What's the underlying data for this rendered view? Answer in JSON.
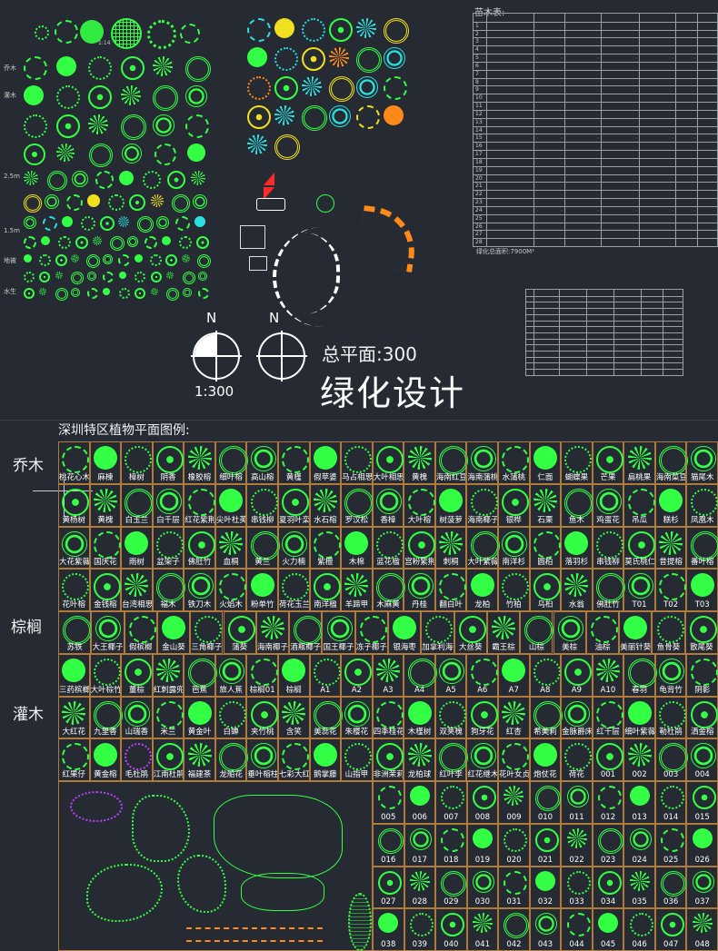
{
  "top": {
    "scale_left": "1:300",
    "north_left": "N",
    "north_right": "N",
    "plan_title": "总平面:300",
    "main_title": "绿化设计",
    "table_title": "苗木表:",
    "table_footer": "绿化总面积:7900M²",
    "table_rows": [
      "1",
      "2",
      "3",
      "4",
      "5",
      "6",
      "7",
      "8",
      "9",
      "10",
      "11",
      "12",
      "13",
      "14",
      "15",
      "16",
      "17",
      "18",
      "19",
      "20",
      "21",
      "22",
      "23",
      "24",
      "25",
      "26",
      "27",
      "28"
    ],
    "left_small_labels": [
      "乔木",
      "灌木",
      "2.5m",
      "1.5m",
      "地被",
      "水生"
    ]
  },
  "legend": {
    "heading": "深圳特区植物平面图例:",
    "sections": [
      "乔木",
      "棕榈",
      "灌木"
    ],
    "row1": [
      "桃花心木",
      "麻楝",
      "樟树",
      "阴香",
      "橡胶榕",
      "细叶榕",
      "高山榕",
      "黄槿",
      "假苹婆",
      "马占相思",
      "大叶相思",
      "黄槐",
      "海南红豆",
      "海南蒲桃",
      "水蒲桃",
      "仁面",
      "蝴蝶果",
      "芒果",
      "扁桃果",
      "海南菜豆",
      "猫尾木"
    ],
    "row2": [
      "黄杨树",
      "黄槐",
      "白玉兰",
      "白千层",
      "红花紫荆",
      "尖叶杜英",
      "串钱柳",
      "夏羽叶栾",
      "水石榕",
      "罗汉松",
      "香樟",
      "大叶榕",
      "树菠萝",
      "海南椰子",
      "银桦",
      "石栗",
      "鱼木",
      "鸡蛋花",
      "吊瓜",
      "糕杉",
      "凤凰木"
    ],
    "row3": [
      "大花紫薇",
      "国庆花",
      "雨树",
      "盆架子",
      "佛肚竹",
      "血桐",
      "黄兰",
      "火力楠",
      "紫檀",
      "木棉",
      "蓝花楹",
      "宫粉紫荆",
      "刺桐",
      "大叶紫薇",
      "南洋杉",
      "圆柏",
      "落羽杉",
      "串钱柳",
      "莫氏桃仁",
      "昔提榕",
      "番叶榕"
    ],
    "row4": [
      "花叶榕",
      "金钱榕",
      "台湾相思",
      "福木",
      "铁刀木",
      "火焰木",
      "粉单竹",
      "荷花玉兰",
      "南洋楹",
      "羊蹄甲",
      "木麻黄",
      "丹桂",
      "翻白叶",
      "龙柏",
      "竹柏",
      "乌桕",
      "水翁",
      "佛肚竹",
      "T01",
      "T02",
      "T03"
    ],
    "row5": [
      "苏铁",
      "大王椰子",
      "假槟榔",
      "金山葵",
      "三角椰子",
      "蒲葵",
      "海南椰子",
      "酒瓶椰子",
      "国王椰子",
      "冻子椰子",
      "银海枣",
      "加拿利海枣",
      "大丝葵",
      "霸王棕",
      "山棕",
      "美棕",
      "油棕",
      "美丽针葵",
      "鱼骨葵",
      "散尾葵"
    ],
    "row6": [
      "三药槟榔",
      "大叶棕竹",
      "董棕",
      "红刺露兜",
      "芭蕉",
      "旅人蕉",
      "棕榈01",
      "棕榈",
      "A1",
      "A2",
      "A3",
      "A4",
      "A5",
      "A6",
      "A7",
      "A8",
      "A9",
      "A10",
      "春羽",
      "龟背竹",
      "阴影"
    ],
    "row7": [
      "大红花",
      "九里香",
      "山瑞香",
      "米兰",
      "黄金叶",
      "白蝉",
      "夹竹桃",
      "含笑",
      "美蕊花",
      "朱樱花",
      "四季桂花",
      "木槿树",
      "双荚槐",
      "狗牙花",
      "红杏",
      "希美莉",
      "金脉爵床",
      "红千层",
      "细叶紫薇",
      "勒杜鹃",
      "洒金榕"
    ],
    "row8": [
      "红果仔",
      "黄金榕",
      "毛杜鹃",
      "江南杜鹃",
      "福建茶",
      "龙船花",
      "垂叶榕柱",
      "七彩大红花",
      "鹅掌藤",
      "山指甲",
      "非洲茉莉",
      "龙柏球",
      "红叶李",
      "红花继木",
      "花叶女贞",
      "炮仗花",
      "荷花",
      "001",
      "002",
      "003",
      "004"
    ],
    "rows_num": [
      [
        "005",
        "006",
        "007",
        "008",
        "009",
        "010",
        "011",
        "012",
        "013",
        "014",
        "015"
      ],
      [
        "016",
        "017",
        "018",
        "019",
        "020",
        "021",
        "022",
        "023",
        "024",
        "025",
        "026"
      ],
      [
        "027",
        "028",
        "029",
        "030",
        "031",
        "032",
        "033",
        "034",
        "035",
        "036",
        "037"
      ],
      [
        "038",
        "039",
        "040",
        "041",
        "042",
        "043",
        "044",
        "045",
        "046",
        "047",
        "048"
      ]
    ]
  },
  "colors": {
    "bg": "#262b33",
    "green": "#33ff44",
    "grid": "#b07a3a",
    "cyan": "#29e0e0",
    "yellow": "#f0e020",
    "orange": "#ff8a1a",
    "red": "#ff2a2a"
  }
}
